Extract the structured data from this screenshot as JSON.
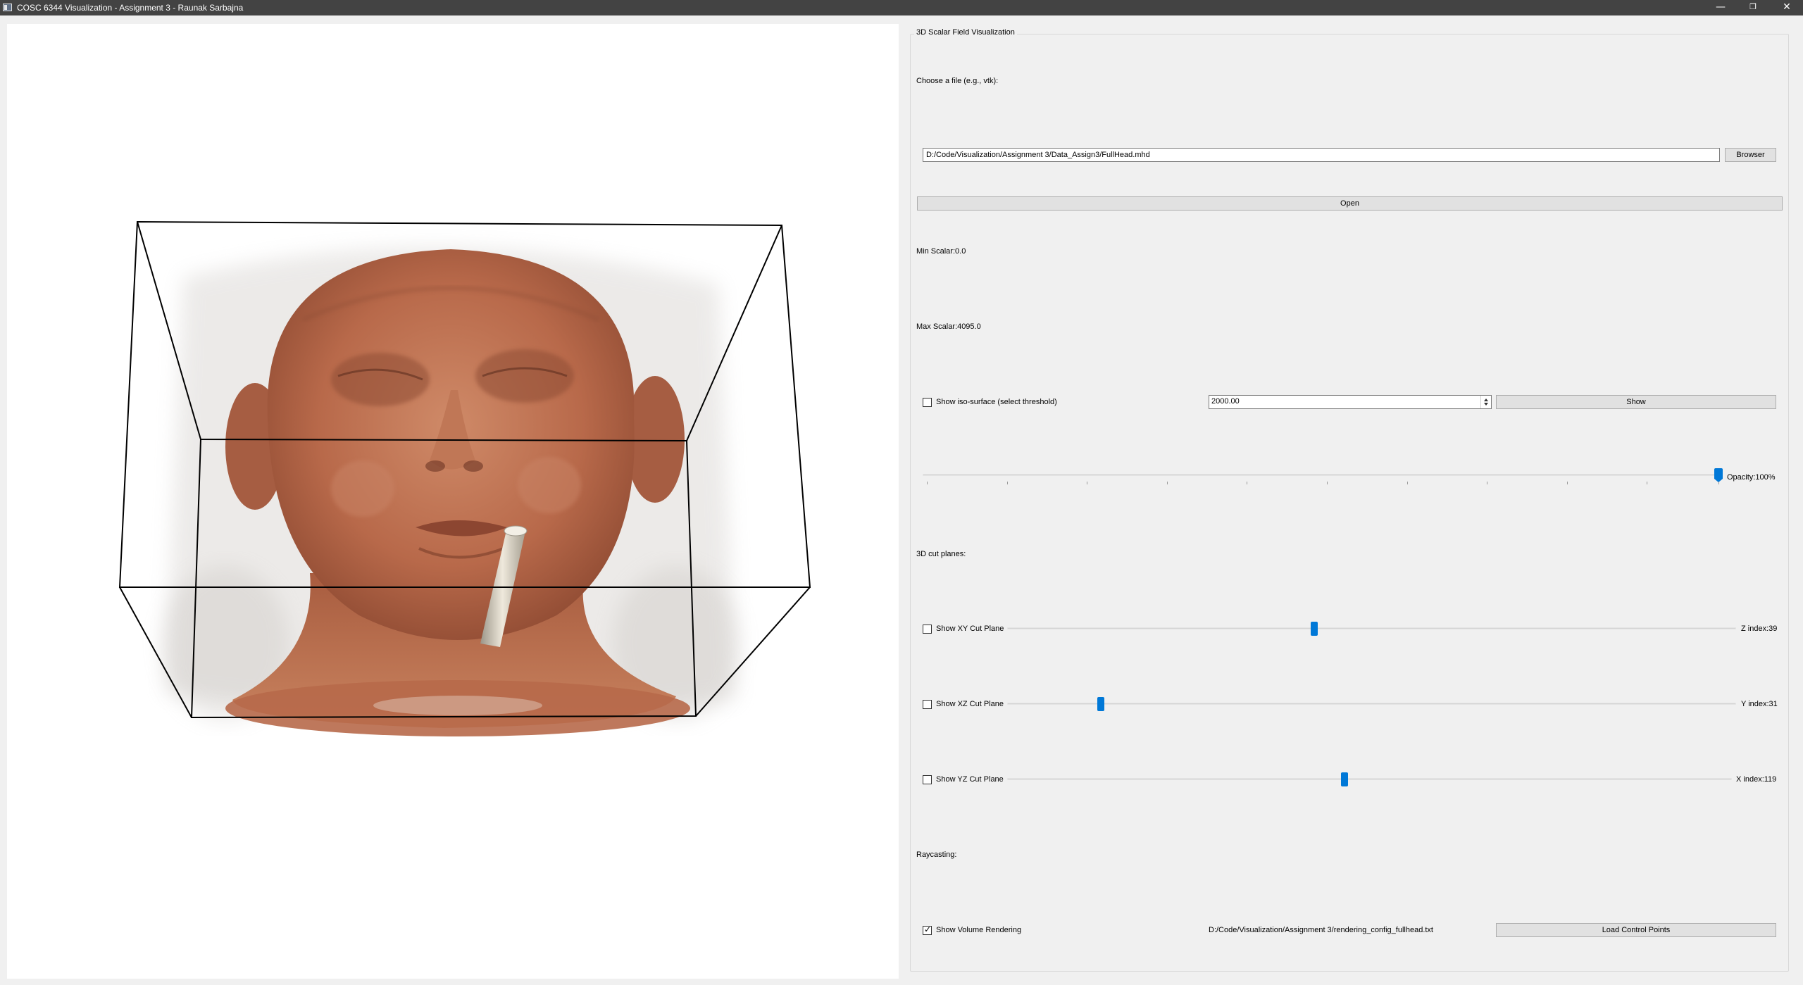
{
  "window": {
    "title": "COSC 6344 Visualization - Assignment 3 - Raunak Sarbajna",
    "minimize_glyph": "—",
    "maximize_glyph": "❐",
    "close_glyph": "✕"
  },
  "panel": {
    "group_title": "3D Scalar Field Visualization",
    "file_label": "Choose a file (e.g., vtk):",
    "file_path": "D:/Code/Visualization/Assignment 3/Data_Assign3/FullHead.mhd",
    "browse_label": "Browser",
    "open_label": "Open",
    "min_scalar_label": "Min Scalar:0.0",
    "max_scalar_label": "Max Scalar:4095.0"
  },
  "isosurface": {
    "checkbox_label": "Show iso-surface (select threshold)",
    "checked": false,
    "threshold_value": "2000.00",
    "show_label": "Show",
    "opacity_label": "Opacity:100%",
    "opacity_fraction": 1.0
  },
  "cut_planes": {
    "section_label": "3D cut planes:",
    "xy": {
      "label": "Show XY Cut Plane",
      "checked": false,
      "index_label": "Z index:39",
      "position_fraction": 0.42
    },
    "xz": {
      "label": "Show XZ Cut Plane",
      "checked": false,
      "index_label": "Y index:31",
      "position_fraction": 0.125
    },
    "yz": {
      "label": "Show YZ Cut Plane",
      "checked": false,
      "index_label": "X index:119",
      "position_fraction": 0.465
    }
  },
  "raycasting": {
    "section_label": "Raycasting:",
    "checkbox_label": "Show Volume Rendering",
    "checked": true,
    "config_path": "D:/Code/Visualization/Assignment 3/rendering_config_fullhead.txt",
    "load_label": "Load Control Points"
  },
  "colors": {
    "slider_handle": "#0078d7",
    "volume_skin": "#b8694a",
    "titlebar": "#434343"
  }
}
